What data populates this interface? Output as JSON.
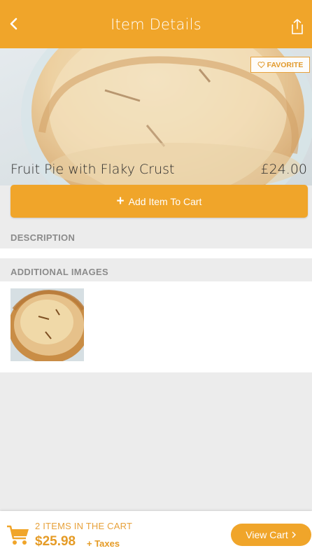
{
  "header": {
    "title": "Item Details",
    "back_icon": "chevron-left-icon",
    "share_icon": "share-icon"
  },
  "item": {
    "favorite_label": "FAVORITE",
    "name": "Fruit Pie with Flaky Crust",
    "price": "£24.00",
    "add_to_cart_label": "Add Item To Cart"
  },
  "sections": {
    "description": "DESCRIPTION",
    "additional_images": "ADDITIONAL IMAGES"
  },
  "footer": {
    "items_in_cart": "2 ITEMS IN THE CART",
    "total": "$25.98",
    "taxes": "+ Taxes",
    "view_cart_label": "View Cart"
  },
  "colors": {
    "accent": "#f0a52a",
    "accent_text": "#e59b26",
    "section_bg": "#ececec"
  }
}
